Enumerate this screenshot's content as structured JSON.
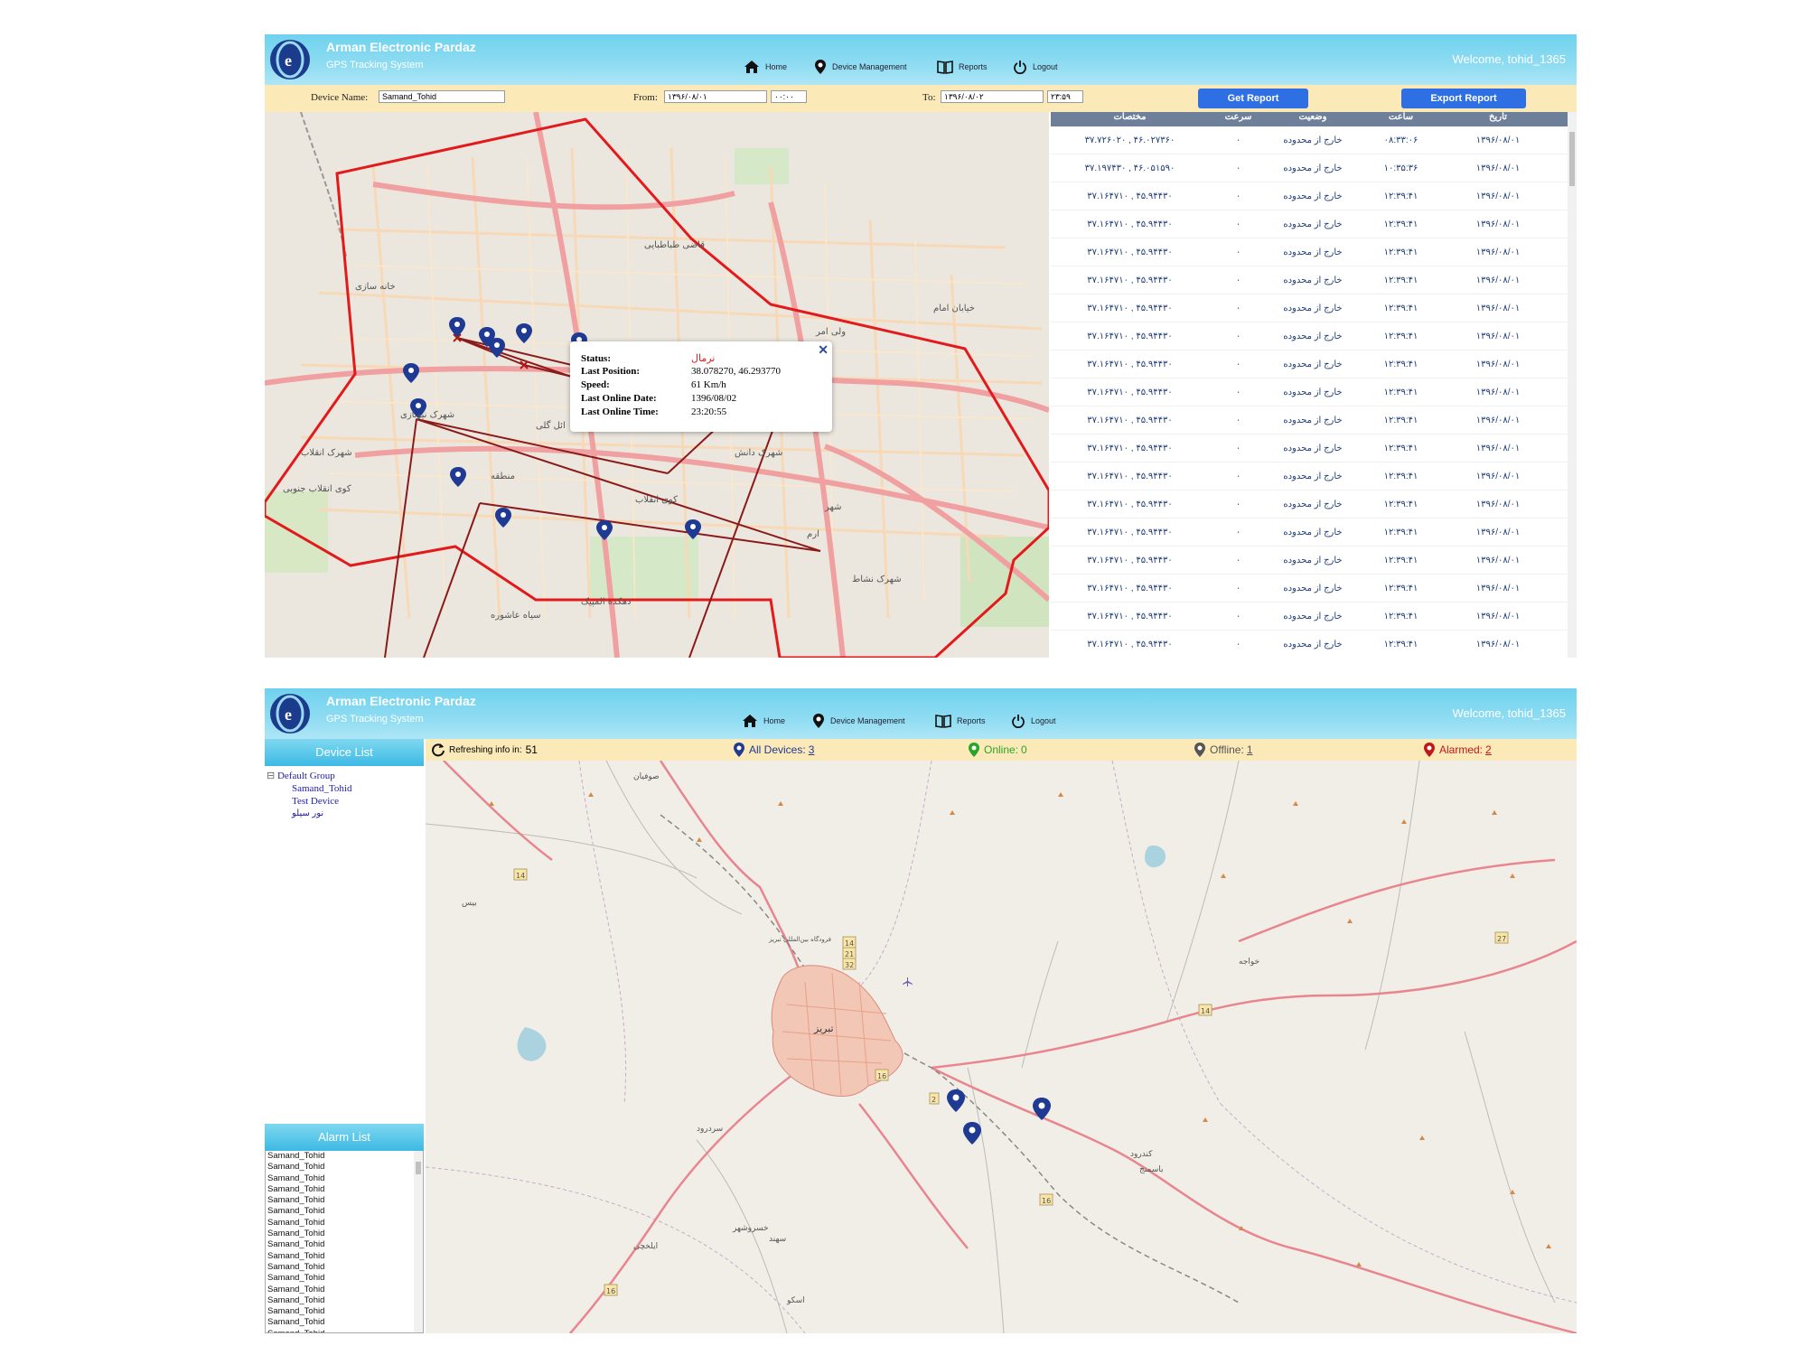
{
  "app": {
    "company": "Arman Electronic Pardaz",
    "subtitle": "GPS Tracking System",
    "welcome": "Welcome, tohid_1365",
    "nav": {
      "home": "Home",
      "device_management": "Device Management",
      "reports": "Reports",
      "logout": "Logout"
    }
  },
  "report": {
    "device_name_label": "Device Name:",
    "device_name_value": "Samand_Tohid",
    "from_label": "From:",
    "from_date": "۱۳۹۶/۰۸/۰۱",
    "from_time": "۰۰:۰۰",
    "to_label": "To:",
    "to_date": "۱۳۹۶/۰۸/۰۲",
    "to_time": "۲۳:۵۹",
    "get_report": "Get Report",
    "export_report": "Export Report",
    "columns": {
      "coords": "مختصات",
      "speed": "سرعت",
      "status": "وضعیت",
      "time": "ساعت",
      "date": "تاریخ"
    },
    "rows": [
      {
        "coords": "۳۷.۷۲۶۰۲۰ , ۴۶.۰۲۷۳۶۰",
        "speed": "۰",
        "status": "خارج از محدوده",
        "time": "۰۸:۳۳:۰۶",
        "date": "۱۳۹۶/۰۸/۰۱"
      },
      {
        "coords": "۳۷.۱۹۷۴۳۰ , ۴۶.۰۵۱۵۹۰",
        "speed": "۰",
        "status": "خارج از محدوده",
        "time": "۱۰:۳۵:۳۶",
        "date": "۱۳۹۶/۰۸/۰۱"
      },
      {
        "coords": "۳۷.۱۶۴۷۱۰ , ۴۵.۹۴۴۳۰",
        "speed": "۰",
        "status": "خارج از محدوده",
        "time": "۱۲:۳۹:۴۱",
        "date": "۱۳۹۶/۰۸/۰۱"
      },
      {
        "coords": "۳۷.۱۶۴۷۱۰ , ۴۵.۹۴۴۳۰",
        "speed": "۰",
        "status": "خارج از محدوده",
        "time": "۱۲:۳۹:۴۱",
        "date": "۱۳۹۶/۰۸/۰۱"
      },
      {
        "coords": "۳۷.۱۶۴۷۱۰ , ۴۵.۹۴۴۳۰",
        "speed": "۰",
        "status": "خارج از محدوده",
        "time": "۱۲:۳۹:۴۱",
        "date": "۱۳۹۶/۰۸/۰۱"
      },
      {
        "coords": "۳۷.۱۶۴۷۱۰ , ۴۵.۹۴۴۳۰",
        "speed": "۰",
        "status": "خارج از محدوده",
        "time": "۱۲:۳۹:۴۱",
        "date": "۱۳۹۶/۰۸/۰۱"
      },
      {
        "coords": "۳۷.۱۶۴۷۱۰ , ۴۵.۹۴۴۳۰",
        "speed": "۰",
        "status": "خارج از محدوده",
        "time": "۱۲:۳۹:۴۱",
        "date": "۱۳۹۶/۰۸/۰۱"
      },
      {
        "coords": "۳۷.۱۶۴۷۱۰ , ۴۵.۹۴۴۳۰",
        "speed": "۰",
        "status": "خارج از محدوده",
        "time": "۱۲:۳۹:۴۱",
        "date": "۱۳۹۶/۰۸/۰۱"
      },
      {
        "coords": "۳۷.۱۶۴۷۱۰ , ۴۵.۹۴۴۳۰",
        "speed": "۰",
        "status": "خارج از محدوده",
        "time": "۱۲:۳۹:۴۱",
        "date": "۱۳۹۶/۰۸/۰۱"
      },
      {
        "coords": "۳۷.۱۶۴۷۱۰ , ۴۵.۹۴۴۳۰",
        "speed": "۰",
        "status": "خارج از محدوده",
        "time": "۱۲:۳۹:۴۱",
        "date": "۱۳۹۶/۰۸/۰۱"
      },
      {
        "coords": "۳۷.۱۶۴۷۱۰ , ۴۵.۹۴۴۳۰",
        "speed": "۰",
        "status": "خارج از محدوده",
        "time": "۱۲:۳۹:۴۱",
        "date": "۱۳۹۶/۰۸/۰۱"
      },
      {
        "coords": "۳۷.۱۶۴۷۱۰ , ۴۵.۹۴۴۳۰",
        "speed": "۰",
        "status": "خارج از محدوده",
        "time": "۱۲:۳۹:۴۱",
        "date": "۱۳۹۶/۰۸/۰۱"
      },
      {
        "coords": "۳۷.۱۶۴۷۱۰ , ۴۵.۹۴۴۳۰",
        "speed": "۰",
        "status": "خارج از محدوده",
        "time": "۱۲:۳۹:۴۱",
        "date": "۱۳۹۶/۰۸/۰۱"
      },
      {
        "coords": "۳۷.۱۶۴۷۱۰ , ۴۵.۹۴۴۳۰",
        "speed": "۰",
        "status": "خارج از محدوده",
        "time": "۱۲:۳۹:۴۱",
        "date": "۱۳۹۶/۰۸/۰۱"
      },
      {
        "coords": "۳۷.۱۶۴۷۱۰ , ۴۵.۹۴۴۳۰",
        "speed": "۰",
        "status": "خارج از محدوده",
        "time": "۱۲:۳۹:۴۱",
        "date": "۱۳۹۶/۰۸/۰۱"
      },
      {
        "coords": "۳۷.۱۶۴۷۱۰ , ۴۵.۹۴۴۳۰",
        "speed": "۰",
        "status": "خارج از محدوده",
        "time": "۱۲:۳۹:۴۱",
        "date": "۱۳۹۶/۰۸/۰۱"
      },
      {
        "coords": "۳۷.۱۶۴۷۱۰ , ۴۵.۹۴۴۳۰",
        "speed": "۰",
        "status": "خارج از محدوده",
        "time": "۱۲:۳۹:۴۱",
        "date": "۱۳۹۶/۰۸/۰۱"
      },
      {
        "coords": "۳۷.۱۶۴۷۱۰ , ۴۵.۹۴۴۳۰",
        "speed": "۰",
        "status": "خارج از محدوده",
        "time": "۱۲:۳۹:۴۱",
        "date": "۱۳۹۶/۰۸/۰۱"
      },
      {
        "coords": "۳۷.۱۶۴۷۱۰ , ۴۵.۹۴۴۳۰",
        "speed": "۰",
        "status": "خارج از محدوده",
        "time": "۱۲:۳۹:۴۱",
        "date": "۱۳۹۶/۰۸/۰۱"
      },
      {
        "coords": "۳۷.۱۶۴۷۱۰ , ۴۵.۹۴۴۳۰",
        "speed": "۰",
        "status": "خارج از محدوده",
        "time": "۱۲:۳۹:۴۱",
        "date": "۱۳۹۶/۰۸/۰۱"
      }
    ]
  },
  "popup": {
    "status_label": "Status:",
    "status_value": "نرمال",
    "position_label": "Last Position:",
    "position_value": "38.078270, 46.293770",
    "speed_label": "Speed:",
    "speed_value": "61 Km/h",
    "date_label": "Last Online Date:",
    "date_value": "1396/08/02",
    "time_label": "Last Online Time:",
    "time_value": "23:20:55"
  },
  "map1_labels": [
    "ولی امر",
    "خانه سازی",
    "شهرک نیوبازی",
    "خیابان امام",
    "ائل گلی",
    "کوی انقلاب",
    "سیاه عاشوره",
    "شهرک نشاط",
    "منطقه",
    "شهرک دانش",
    "قاضی طباطبایی",
    "ارم",
    "شهر",
    "دهکده المپیک",
    "شهرک انقلاب",
    "کوی انقلاب جنوبی"
  ],
  "map2_labels": [
    "صوفیان",
    "بیس",
    "خواجه",
    "تبریز",
    "فرودگاه بین‌المللی تبریز",
    "سردرود",
    "کندرود",
    "باسمنج",
    "خسروشهر",
    "سهند",
    "ایلخچی",
    "اسکو",
    "14",
    "21",
    "32",
    "16",
    "2",
    "27"
  ],
  "dashboard": {
    "device_list_title": "Device List",
    "group_name": "Default Group",
    "devices": [
      "Samand_Tohid",
      "Test Device",
      "نور سیلو"
    ],
    "alarm_list_title": "Alarm List",
    "alarms": [
      "Samand_Tohid",
      "Samand_Tohid",
      "Samand_Tohid",
      "Samand_Tohid",
      "Samand_Tohid",
      "Samand_Tohid",
      "Samand_Tohid",
      "Samand_Tohid",
      "Samand_Tohid",
      "Samand_Tohid",
      "Samand_Tohid",
      "Samand_Tohid",
      "Samand_Tohid",
      "Samand_Tohid",
      "Samand_Tohid",
      "Samand_Tohid",
      "Samand_Tohid",
      "Samand_Tohid",
      "Samand_Tohid",
      "Samand_Tohid",
      "Samand_Tohid",
      "Samand_Tohid"
    ],
    "refresh_label": "Refreshing info in:",
    "refresh_value": "51",
    "all_devices_label": "All Devices:",
    "all_devices_count": "3",
    "online_label": "Online:",
    "online_count": "0",
    "offline_label": "Offline:",
    "offline_count": "1",
    "alarmed_label": "Alarmed:",
    "alarmed_count": "2"
  },
  "colors": {
    "header": "#7fd8f0",
    "filter_bar": "#fbe9b8",
    "button": "#2e6fe3",
    "table_header": "#6d7f99",
    "geofence": "#e31a1c",
    "route": "#8b1a1a",
    "marker": "#1f3a93",
    "online": "#2aa52a",
    "offline": "#555555",
    "alarmed": "#c01818"
  },
  "icons": [
    "logo-icon",
    "home-icon",
    "map-pin-icon",
    "book-icon",
    "power-icon",
    "close-icon",
    "refresh-icon",
    "marker-icon",
    "scroll-arrow-icon"
  ]
}
